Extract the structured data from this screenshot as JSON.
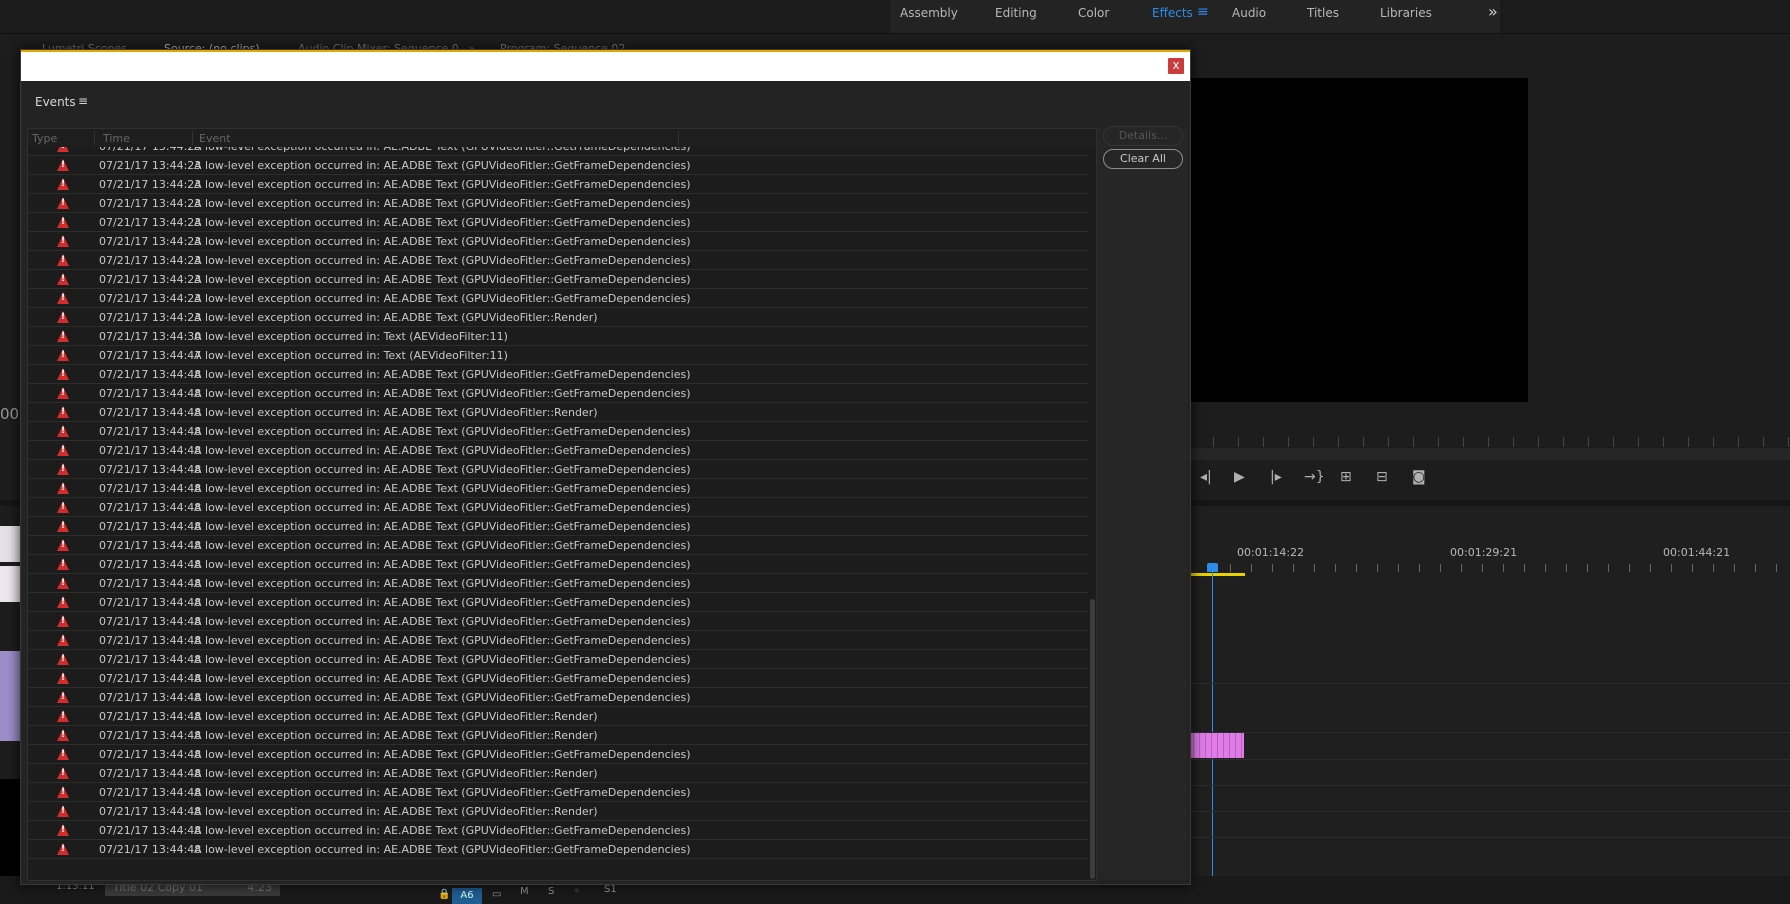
{
  "workspace": {
    "tabs": [
      "Assembly",
      "Editing",
      "Color",
      "Effects",
      "Audio",
      "Titles",
      "Libraries"
    ],
    "active_tab": "Effects",
    "menu_glyph": "≡",
    "more_glyph": "»"
  },
  "background": {
    "left_tabs": [
      "Lumetri Scopes",
      "Source: (no clips)",
      "Audio Clip Mixer: Sequence 0"
    ],
    "left_tabs_more": "»",
    "program_tab": "Program: Sequence 02",
    "left_number": "00",
    "timecodes": [
      "00:01:14:22",
      "00:01:29:21",
      "00:01:44:21"
    ],
    "bottom_timecode": "1:13:11",
    "bottom_clip_name": "Title 02 Copy 01",
    "bottom_clip_duration": "4:23",
    "track_buttons": [
      "A6",
      "M",
      "S",
      "S1"
    ]
  },
  "dialog": {
    "panel_title": "Events",
    "panel_menu": "≡",
    "close_label": "x",
    "columns": [
      "Type",
      "Time",
      "Event"
    ],
    "details_label": "Details...",
    "clear_all_label": "Clear All",
    "events": [
      {
        "time": "07/21/17 13:44:23",
        "event": "A low-level exception occurred in: AE.ADBE Text (GPUVideoFitler::GetFrameDependencies)"
      },
      {
        "time": "07/21/17 13:44:23",
        "event": "A low-level exception occurred in: AE.ADBE Text (GPUVideoFitler::GetFrameDependencies)"
      },
      {
        "time": "07/21/17 13:44:23",
        "event": "A low-level exception occurred in: AE.ADBE Text (GPUVideoFitler::GetFrameDependencies)"
      },
      {
        "time": "07/21/17 13:44:23",
        "event": "A low-level exception occurred in: AE.ADBE Text (GPUVideoFitler::GetFrameDependencies)"
      },
      {
        "time": "07/21/17 13:44:23",
        "event": "A low-level exception occurred in: AE.ADBE Text (GPUVideoFitler::GetFrameDependencies)"
      },
      {
        "time": "07/21/17 13:44:23",
        "event": "A low-level exception occurred in: AE.ADBE Text (GPUVideoFitler::GetFrameDependencies)"
      },
      {
        "time": "07/21/17 13:44:23",
        "event": "A low-level exception occurred in: AE.ADBE Text (GPUVideoFitler::GetFrameDependencies)"
      },
      {
        "time": "07/21/17 13:44:23",
        "event": "A low-level exception occurred in: AE.ADBE Text (GPUVideoFitler::GetFrameDependencies)"
      },
      {
        "time": "07/21/17 13:44:23",
        "event": "A low-level exception occurred in: AE.ADBE Text (GPUVideoFitler::GetFrameDependencies)"
      },
      {
        "time": "07/21/17 13:44:23",
        "event": "A low-level exception occurred in: AE.ADBE Text (GPUVideoFitler::Render)"
      },
      {
        "time": "07/21/17 13:44:30",
        "event": "A low-level exception occurred in: Text (AEVideoFilter:11)"
      },
      {
        "time": "07/21/17 13:44:47",
        "event": "A low-level exception occurred in: Text (AEVideoFilter:11)"
      },
      {
        "time": "07/21/17 13:44:48",
        "event": "A low-level exception occurred in: AE.ADBE Text (GPUVideoFitler::GetFrameDependencies)"
      },
      {
        "time": "07/21/17 13:44:48",
        "event": "A low-level exception occurred in: AE.ADBE Text (GPUVideoFitler::GetFrameDependencies)"
      },
      {
        "time": "07/21/17 13:44:48",
        "event": "A low-level exception occurred in: AE.ADBE Text (GPUVideoFitler::Render)"
      },
      {
        "time": "07/21/17 13:44:48",
        "event": "A low-level exception occurred in: AE.ADBE Text (GPUVideoFitler::GetFrameDependencies)"
      },
      {
        "time": "07/21/17 13:44:48",
        "event": "A low-level exception occurred in: AE.ADBE Text (GPUVideoFitler::GetFrameDependencies)"
      },
      {
        "time": "07/21/17 13:44:48",
        "event": "A low-level exception occurred in: AE.ADBE Text (GPUVideoFitler::GetFrameDependencies)"
      },
      {
        "time": "07/21/17 13:44:48",
        "event": "A low-level exception occurred in: AE.ADBE Text (GPUVideoFitler::GetFrameDependencies)"
      },
      {
        "time": "07/21/17 13:44:48",
        "event": "A low-level exception occurred in: AE.ADBE Text (GPUVideoFitler::GetFrameDependencies)"
      },
      {
        "time": "07/21/17 13:44:48",
        "event": "A low-level exception occurred in: AE.ADBE Text (GPUVideoFitler::GetFrameDependencies)"
      },
      {
        "time": "07/21/17 13:44:48",
        "event": "A low-level exception occurred in: AE.ADBE Text (GPUVideoFitler::GetFrameDependencies)"
      },
      {
        "time": "07/21/17 13:44:48",
        "event": "A low-level exception occurred in: AE.ADBE Text (GPUVideoFitler::GetFrameDependencies)"
      },
      {
        "time": "07/21/17 13:44:48",
        "event": "A low-level exception occurred in: AE.ADBE Text (GPUVideoFitler::GetFrameDependencies)"
      },
      {
        "time": "07/21/17 13:44:48",
        "event": "A low-level exception occurred in: AE.ADBE Text (GPUVideoFitler::GetFrameDependencies)"
      },
      {
        "time": "07/21/17 13:44:48",
        "event": "A low-level exception occurred in: AE.ADBE Text (GPUVideoFitler::GetFrameDependencies)"
      },
      {
        "time": "07/21/17 13:44:48",
        "event": "A low-level exception occurred in: AE.ADBE Text (GPUVideoFitler::GetFrameDependencies)"
      },
      {
        "time": "07/21/17 13:44:48",
        "event": "A low-level exception occurred in: AE.ADBE Text (GPUVideoFitler::GetFrameDependencies)"
      },
      {
        "time": "07/21/17 13:44:48",
        "event": "A low-level exception occurred in: AE.ADBE Text (GPUVideoFitler::GetFrameDependencies)"
      },
      {
        "time": "07/21/17 13:44:48",
        "event": "A low-level exception occurred in: AE.ADBE Text (GPUVideoFitler::GetFrameDependencies)"
      },
      {
        "time": "07/21/17 13:44:48",
        "event": "A low-level exception occurred in: AE.ADBE Text (GPUVideoFitler::Render)"
      },
      {
        "time": "07/21/17 13:44:48",
        "event": "A low-level exception occurred in: AE.ADBE Text (GPUVideoFitler::Render)"
      },
      {
        "time": "07/21/17 13:44:48",
        "event": "A low-level exception occurred in: AE.ADBE Text (GPUVideoFitler::GetFrameDependencies)"
      },
      {
        "time": "07/21/17 13:44:48",
        "event": "A low-level exception occurred in: AE.ADBE Text (GPUVideoFitler::Render)"
      },
      {
        "time": "07/21/17 13:44:48",
        "event": "A low-level exception occurred in: AE.ADBE Text (GPUVideoFitler::GetFrameDependencies)"
      },
      {
        "time": "07/21/17 13:44:48",
        "event": "A low-level exception occurred in: AE.ADBE Text (GPUVideoFitler::Render)"
      },
      {
        "time": "07/21/17 13:44:48",
        "event": "A low-level exception occurred in: AE.ADBE Text (GPUVideoFitler::GetFrameDependencies)"
      },
      {
        "time": "07/21/17 13:44:48",
        "event": "A low-level exception occurred in: AE.ADBE Text (GPUVideoFitler::GetFrameDependencies)"
      }
    ],
    "event_icon": "warning-triangle-icon"
  },
  "colors": {
    "accent": "#2d8ceb",
    "warning": "#d22c2c",
    "title_bar_stripe": "#e8a600",
    "close_button": "#cc3b3b"
  }
}
